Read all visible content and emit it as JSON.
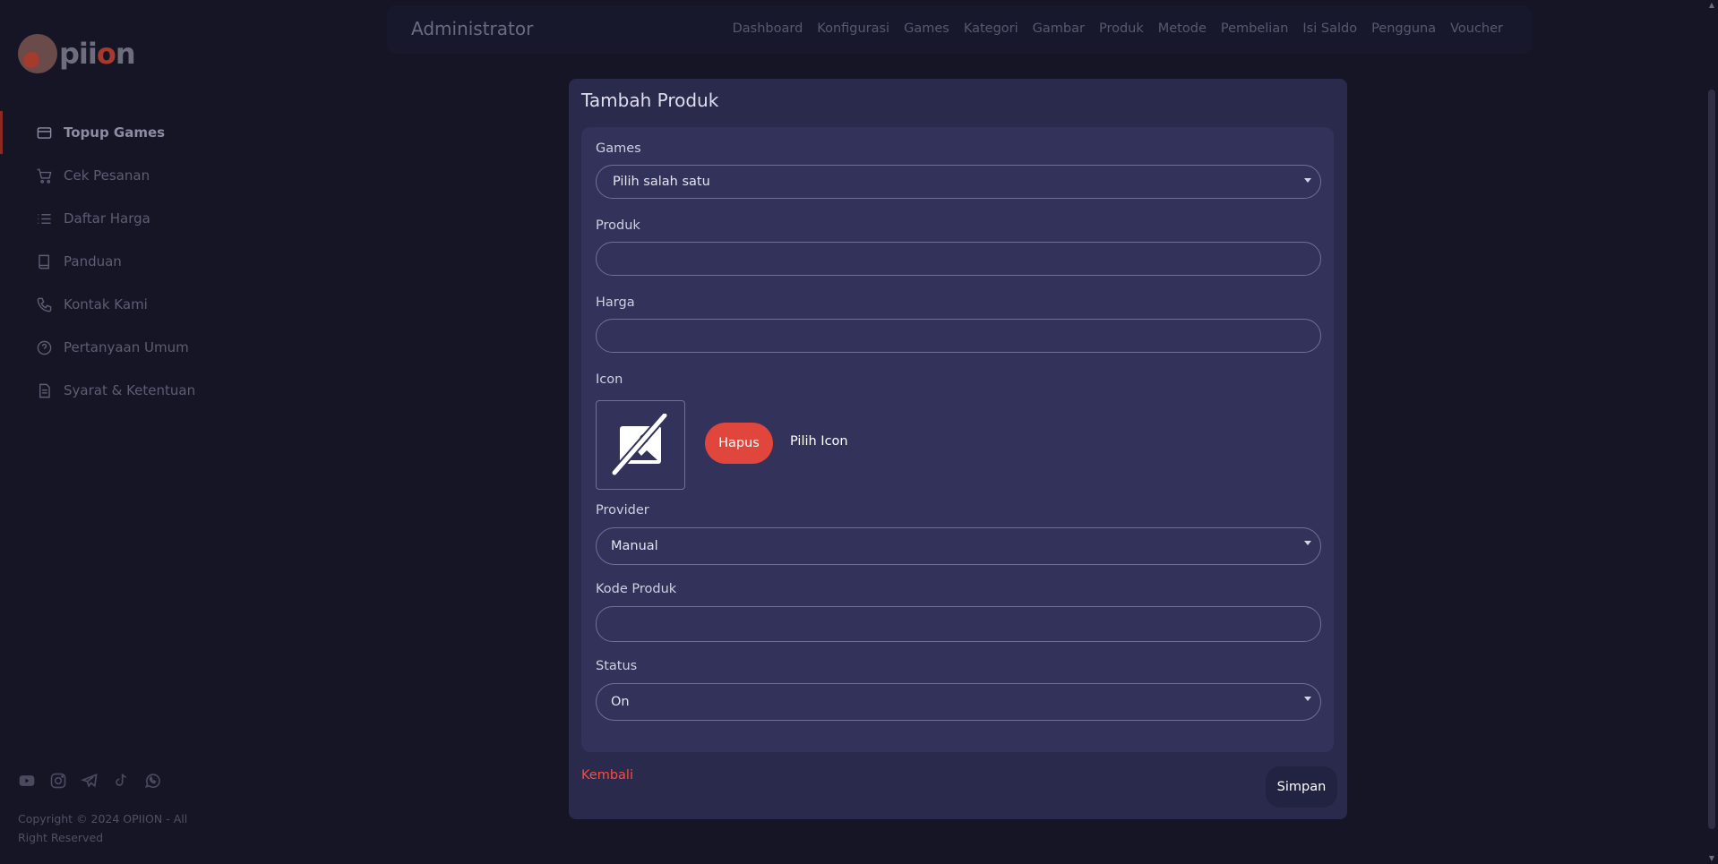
{
  "brand": {
    "logo_text_a": "pii",
    "logo_text_b": "o",
    "logo_text_c": "n"
  },
  "sidebar": {
    "items": [
      {
        "label": "Topup Games",
        "icon": "credit-card-icon",
        "active": true
      },
      {
        "label": "Cek Pesanan",
        "icon": "cart-icon"
      },
      {
        "label": "Daftar Harga",
        "icon": "list-icon"
      },
      {
        "label": "Panduan",
        "icon": "book-icon"
      },
      {
        "label": "Kontak Kami",
        "icon": "phone-icon"
      },
      {
        "label": "Pertanyaan Umum",
        "icon": "question-icon"
      },
      {
        "label": "Syarat & Ketentuan",
        "icon": "document-icon"
      }
    ],
    "socials": [
      "youtube-icon",
      "instagram-icon",
      "telegram-icon",
      "tiktok-icon",
      "whatsapp-icon"
    ],
    "copyright": "Copyright © 2024 OPIION - All Right Reserved"
  },
  "header": {
    "title": "Administrator",
    "nav": [
      "Dashboard",
      "Konfigurasi",
      "Games",
      "Kategori",
      "Gambar",
      "Produk",
      "Metode",
      "Pembelian",
      "Isi Saldo",
      "Pengguna",
      "Voucher"
    ]
  },
  "form": {
    "title": "Tambah Produk",
    "games_label": "Games",
    "games_value": "Pilih salah satu",
    "produk_label": "Produk",
    "produk_value": "",
    "harga_label": "Harga",
    "harga_value": "",
    "icon_label": "Icon",
    "hapus_label": "Hapus",
    "pilih_icon_label": "Pilih Icon",
    "provider_label": "Provider",
    "provider_value": "Manual",
    "kode_label": "Kode Produk",
    "kode_value": "",
    "status_label": "Status",
    "status_value": "On",
    "kembali_label": "Kembali",
    "simpan_label": "Simpan"
  },
  "colors": {
    "accent_red": "#e0463c",
    "link_red": "#ff4a3e",
    "card_bg": "#2a2a4c",
    "panel_bg": "#32325a",
    "page_bg": "#151526"
  }
}
